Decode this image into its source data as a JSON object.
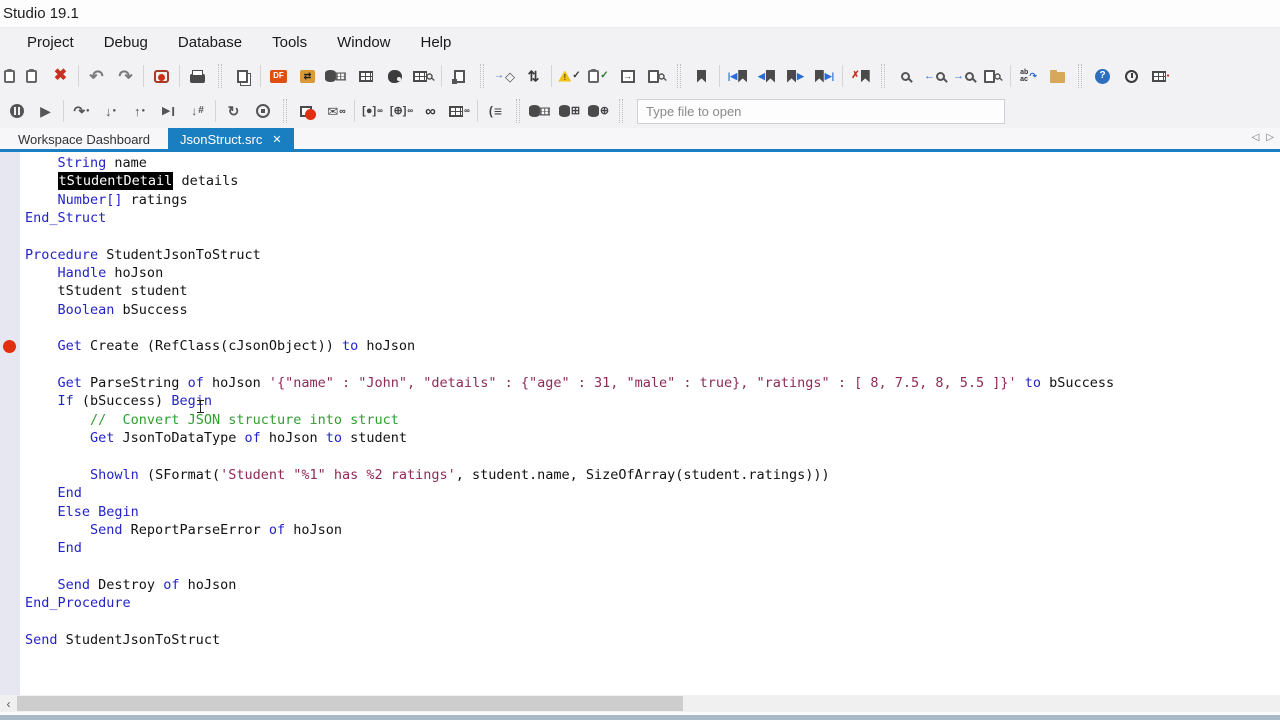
{
  "window": {
    "title": "Studio 19.1"
  },
  "menu": {
    "items": [
      "Project",
      "Debug",
      "Database",
      "Tools",
      "Window",
      "Help"
    ]
  },
  "toolbars": {
    "row1": [
      {
        "name": "paste-edge-icon",
        "w": 15,
        "parts": [
          {
            "cls": "clip"
          }
        ]
      },
      {
        "name": "paste-icon",
        "parts": [
          {
            "cls": "clip"
          }
        ]
      },
      {
        "name": "delete-icon",
        "parts": [
          {
            "g": "✖",
            "c": "#c5321f",
            "s": 16,
            "b": 1
          }
        ]
      },
      {
        "type": "sep"
      },
      {
        "name": "undo-icon",
        "parts": [
          {
            "g": "↶",
            "c": "#7a7a7a",
            "s": 17,
            "b": 1
          }
        ]
      },
      {
        "name": "redo-icon",
        "parts": [
          {
            "g": "↷",
            "c": "#7a7a7a",
            "s": 17,
            "b": 1
          }
        ]
      },
      {
        "type": "sep"
      },
      {
        "name": "compile-icon",
        "parts": [
          {
            "cls": "rec"
          }
        ]
      },
      {
        "type": "sep"
      },
      {
        "name": "print-icon",
        "parts": [
          {
            "cls": "prn"
          }
        ]
      },
      {
        "type": "grip"
      },
      {
        "name": "copy-code-icon",
        "parts": [
          {
            "cls": "doc2"
          }
        ]
      },
      {
        "type": "sep"
      },
      {
        "name": "dataflex-studio-icon",
        "parts": [
          {
            "cls": "df",
            "g": "DF"
          }
        ]
      },
      {
        "name": "df-migrate-icon",
        "parts": [
          {
            "cls": "dfo",
            "g": "⇄"
          }
        ]
      },
      {
        "name": "data-dictionary-icon",
        "parts": [
          {
            "cls": "cyl"
          },
          {
            "cls": "tbl sm"
          }
        ]
      },
      {
        "name": "table-editor-icon",
        "parts": [
          {
            "cls": "tbl"
          }
        ]
      },
      {
        "name": "styles-icon",
        "parts": [
          {
            "cls": "pal"
          }
        ]
      },
      {
        "name": "table-lookup-icon",
        "parts": [
          {
            "cls": "tbl"
          },
          {
            "cls": "mag sm"
          }
        ]
      },
      {
        "type": "sep"
      },
      {
        "name": "new-file-icon",
        "parts": [
          {
            "cls": "docsq"
          }
        ]
      },
      {
        "type": "grip"
      },
      {
        "name": "deploy-icon",
        "parts": [
          {
            "g": "→",
            "c": "#2b6cd4",
            "s": 10,
            "b": 1
          },
          {
            "g": "◇",
            "c": "#555",
            "s": 13
          }
        ]
      },
      {
        "name": "references-icon",
        "parts": [
          {
            "g": "⇅",
            "c": "#3a3a3a",
            "s": 14,
            "b": 1
          }
        ]
      },
      {
        "type": "sep"
      },
      {
        "name": "check-errors-icon",
        "parts": [
          {
            "cls": "warn",
            "g": "!"
          },
          {
            "g": "✓",
            "c": "#333",
            "s": 10,
            "b": 1
          }
        ]
      },
      {
        "name": "todo-list-icon",
        "parts": [
          {
            "cls": "clip"
          },
          {
            "g": "✓",
            "c": "#2a7a2a",
            "s": 10,
            "b": 1
          }
        ]
      },
      {
        "name": "run-program-icon",
        "parts": [
          {
            "cls": "docarr",
            "g": "→"
          }
        ]
      },
      {
        "name": "preview-icon",
        "parts": [
          {
            "cls": "doc"
          },
          {
            "cls": "mag sm"
          }
        ]
      },
      {
        "type": "grip"
      },
      {
        "name": "toggle-bookmark-icon",
        "parts": [
          {
            "cls": "bm"
          }
        ]
      },
      {
        "type": "sep"
      },
      {
        "name": "first-bookmark-icon",
        "parts": [
          {
            "g": "|◀",
            "c": "#2b6cd4",
            "s": 9,
            "b": 1
          },
          {
            "cls": "bm"
          }
        ]
      },
      {
        "name": "prev-bookmark-icon",
        "parts": [
          {
            "g": "◀",
            "c": "#2b6cd4",
            "s": 9,
            "b": 1
          },
          {
            "cls": "bm"
          }
        ]
      },
      {
        "name": "next-bookmark-icon",
        "parts": [
          {
            "cls": "bm"
          },
          {
            "g": "▶",
            "c": "#2b6cd4",
            "s": 9,
            "b": 1
          }
        ]
      },
      {
        "name": "last-bookmark-icon",
        "parts": [
          {
            "cls": "bm"
          },
          {
            "g": "▶|",
            "c": "#2b6cd4",
            "s": 9,
            "b": 1
          }
        ]
      },
      {
        "type": "sep"
      },
      {
        "name": "clear-bookmarks-icon",
        "parts": [
          {
            "g": "✗",
            "c": "#c5321f",
            "s": 10,
            "b": 1
          },
          {
            "cls": "bm"
          }
        ]
      },
      {
        "type": "grip"
      },
      {
        "name": "find-icon",
        "parts": [
          {
            "cls": "mag"
          }
        ]
      },
      {
        "name": "find-prev-icon",
        "parts": [
          {
            "g": "←",
            "c": "#2b6cd4",
            "s": 11,
            "b": 1
          },
          {
            "cls": "mag"
          }
        ]
      },
      {
        "name": "find-next-icon",
        "parts": [
          {
            "g": "→",
            "c": "#2b6cd4",
            "s": 11,
            "b": 1
          },
          {
            "cls": "mag"
          }
        ]
      },
      {
        "name": "find-in-files-icon",
        "parts": [
          {
            "cls": "doc"
          },
          {
            "cls": "mag sm"
          }
        ]
      },
      {
        "type": "sep"
      },
      {
        "name": "replace-icon",
        "parts": [
          {
            "cls": "rep",
            "g": "ab\nac"
          },
          {
            "g": "↷",
            "c": "#2b6cd4",
            "s": 9,
            "b": 1
          }
        ]
      },
      {
        "name": "replace-in-files-icon",
        "parts": [
          {
            "cls": "fold"
          }
        ]
      },
      {
        "type": "grip"
      },
      {
        "name": "help-icon",
        "parts": [
          {
            "cls": "help",
            "g": "?"
          }
        ]
      },
      {
        "name": "whats-new-icon",
        "parts": [
          {
            "cls": "clk"
          }
        ]
      },
      {
        "name": "window-layout-icon",
        "parts": [
          {
            "cls": "tbl"
          },
          {
            "g": "▪",
            "c": "#c5321f",
            "s": 8
          }
        ]
      }
    ],
    "row2": [
      {
        "name": "pause-icon",
        "parts": [
          {
            "cls": "pau"
          }
        ]
      },
      {
        "name": "start-debug-icon",
        "parts": [
          {
            "g": "▶",
            "c": "#555",
            "s": 14
          }
        ]
      },
      {
        "type": "sep"
      },
      {
        "name": "step-over-icon",
        "parts": [
          {
            "g": "↷",
            "c": "#555",
            "s": 14,
            "b": 1
          },
          {
            "g": "●",
            "c": "#555",
            "s": 6
          }
        ]
      },
      {
        "name": "step-into-icon",
        "parts": [
          {
            "g": "↓",
            "c": "#555",
            "s": 13,
            "b": 1
          },
          {
            "g": "●",
            "c": "#555",
            "s": 6
          }
        ]
      },
      {
        "name": "step-out-icon",
        "parts": [
          {
            "g": "↑",
            "c": "#555",
            "s": 13,
            "b": 1
          },
          {
            "g": "●",
            "c": "#555",
            "s": 6
          }
        ]
      },
      {
        "name": "run-to-cursor-icon",
        "parts": [
          {
            "g": "▶",
            "c": "#555",
            "s": 11
          },
          {
            "g": "I",
            "c": "#555",
            "s": 13,
            "b": 1
          }
        ]
      },
      {
        "name": "set-next-statement-icon",
        "parts": [
          {
            "g": "↓",
            "c": "#555",
            "s": 12,
            "b": 1
          },
          {
            "g": "#",
            "c": "#555",
            "s": 10,
            "b": 1
          }
        ]
      },
      {
        "type": "sep"
      },
      {
        "name": "continue-icon",
        "parts": [
          {
            "g": "↻",
            "c": "#555",
            "s": 14,
            "b": 1
          }
        ]
      },
      {
        "name": "stop-debug-icon",
        "parts": [
          {
            "cls": "stp"
          }
        ]
      },
      {
        "type": "grip"
      },
      {
        "name": "toggle-breakpoint-icon",
        "parts": [
          {
            "cls": "winsq"
          },
          {
            "cls": "dotr ov"
          }
        ]
      },
      {
        "name": "breakpoint-list-icon",
        "parts": [
          {
            "g": "✉",
            "c": "#444",
            "s": 13
          },
          {
            "g": "∞",
            "c": "#333",
            "s": 9,
            "b": 1
          }
        ]
      },
      {
        "type": "sep"
      },
      {
        "name": "watch-icon",
        "parts": [
          {
            "g": "[●]",
            "c": "#444",
            "s": 11,
            "b": 1
          },
          {
            "g": "∞",
            "c": "#333",
            "s": 8,
            "b": 1
          }
        ]
      },
      {
        "name": "web-watch-icon",
        "parts": [
          {
            "g": "[⊕]",
            "c": "#444",
            "s": 11,
            "b": 1
          },
          {
            "g": "∞",
            "c": "#333",
            "s": 8,
            "b": 1
          }
        ]
      },
      {
        "name": "locals-icon",
        "parts": [
          {
            "g": "∞",
            "c": "#333",
            "s": 15,
            "b": 1
          }
        ]
      },
      {
        "name": "array-watch-icon",
        "parts": [
          {
            "cls": "tbl"
          },
          {
            "g": "∞",
            "c": "#333",
            "s": 8,
            "b": 1
          }
        ]
      },
      {
        "type": "sep"
      },
      {
        "name": "call-stack-icon",
        "parts": [
          {
            "g": "(",
            "c": "#444",
            "s": 12,
            "b": 1
          },
          {
            "g": "≡",
            "c": "#444",
            "s": 14,
            "b": 1
          }
        ]
      },
      {
        "type": "grip"
      },
      {
        "name": "db-explorer-icon",
        "parts": [
          {
            "cls": "cyl"
          },
          {
            "cls": "tbl sm"
          }
        ]
      },
      {
        "name": "db-builder-icon",
        "parts": [
          {
            "cls": "cyl"
          },
          {
            "g": "⊞",
            "c": "#444",
            "s": 11,
            "b": 1
          }
        ]
      },
      {
        "name": "web-app-server-icon",
        "parts": [
          {
            "cls": "cyl"
          },
          {
            "g": "⊕",
            "c": "#444",
            "s": 11,
            "b": 1
          }
        ]
      },
      {
        "type": "grip"
      }
    ]
  },
  "file_open": {
    "placeholder": "Type file to open"
  },
  "tab_bar": {
    "accent": "#1a7fc1",
    "scroll_left": "◁",
    "scroll_right": "▷",
    "tabs": [
      {
        "label": "Workspace Dashboard",
        "active": false
      },
      {
        "label": "JsonStruct.src",
        "active": true,
        "close": "✕"
      }
    ]
  },
  "editor": {
    "colors": {
      "keyword": "#2323c8",
      "string": "#8e2a56",
      "comment": "#2f9e2f",
      "text": "#121212",
      "highlight_bg": "#000000",
      "highlight_text": "#ffffff",
      "breakpoint": "#e03010"
    },
    "lines": [
      {
        "tokens": [
          [
            "    ",
            "n"
          ],
          [
            "String",
            "k"
          ],
          [
            " name",
            "n"
          ]
        ]
      },
      {
        "tokens": [
          [
            "    ",
            "n"
          ],
          [
            "tStudentDetail",
            "h"
          ],
          [
            " details",
            "n"
          ]
        ]
      },
      {
        "tokens": [
          [
            "    ",
            "n"
          ],
          [
            "Number[]",
            "k"
          ],
          [
            " ratings",
            "n"
          ]
        ]
      },
      {
        "tokens": [
          [
            "End_Struct",
            "k"
          ]
        ]
      },
      {
        "tokens": []
      },
      {
        "tokens": [
          [
            "Procedure",
            "k"
          ],
          [
            " StudentJsonToStruct",
            "n"
          ]
        ]
      },
      {
        "tokens": [
          [
            "    ",
            "n"
          ],
          [
            "Handle",
            "k"
          ],
          [
            " hoJson",
            "n"
          ]
        ]
      },
      {
        "tokens": [
          [
            "    tStudent student",
            "n"
          ]
        ]
      },
      {
        "tokens": [
          [
            "    ",
            "n"
          ],
          [
            "Boolean",
            "k"
          ],
          [
            " bSuccess",
            "n"
          ]
        ]
      },
      {
        "tokens": []
      },
      {
        "bp": true,
        "tokens": [
          [
            "    ",
            "n"
          ],
          [
            "Get",
            "k"
          ],
          [
            " Create (RefClass(cJsonObject)) ",
            "n"
          ],
          [
            "to",
            "k"
          ],
          [
            " hoJson",
            "n"
          ]
        ]
      },
      {
        "tokens": []
      },
      {
        "tokens": [
          [
            "    ",
            "n"
          ],
          [
            "Get",
            "k"
          ],
          [
            " ParseString ",
            "n"
          ],
          [
            "of",
            "k"
          ],
          [
            " hoJson ",
            "n"
          ],
          [
            "'{\"name\" : \"John\", \"details\" : {\"age\" : 31, \"male\" : true}, \"ratings\" : [ 8, 7.5, 8, 5.5 ]}'",
            "s"
          ],
          [
            " ",
            "n"
          ],
          [
            "to",
            "k"
          ],
          [
            " bSuccess",
            "n"
          ]
        ]
      },
      {
        "tokens": [
          [
            "    ",
            "n"
          ],
          [
            "If",
            "k"
          ],
          [
            " (bSuccess) ",
            "n"
          ],
          [
            "Begin",
            "k"
          ]
        ]
      },
      {
        "tokens": [
          [
            "        ",
            "n"
          ],
          [
            "//  Convert JSON structure into struct",
            "c"
          ]
        ]
      },
      {
        "tokens": [
          [
            "        ",
            "n"
          ],
          [
            "Get",
            "k"
          ],
          [
            " JsonToDataType ",
            "n"
          ],
          [
            "of",
            "k"
          ],
          [
            " hoJson ",
            "n"
          ],
          [
            "to",
            "k"
          ],
          [
            " student",
            "n"
          ]
        ]
      },
      {
        "tokens": []
      },
      {
        "tokens": [
          [
            "        ",
            "n"
          ],
          [
            "Showln",
            "k"
          ],
          [
            " (SFormat(",
            "n"
          ],
          [
            "'Student \"%1\" has %2 ratings'",
            "s"
          ],
          [
            ", student.name, SizeOfArray(student.ratings)))",
            "n"
          ]
        ]
      },
      {
        "tokens": [
          [
            "    ",
            "n"
          ],
          [
            "End",
            "k"
          ]
        ]
      },
      {
        "tokens": [
          [
            "    ",
            "n"
          ],
          [
            "Else",
            "k"
          ],
          [
            " ",
            "n"
          ],
          [
            "Begin",
            "k"
          ]
        ]
      },
      {
        "tokens": [
          [
            "        ",
            "n"
          ],
          [
            "Send",
            "k"
          ],
          [
            " ReportParseError ",
            "n"
          ],
          [
            "of",
            "k"
          ],
          [
            " hoJson",
            "n"
          ]
        ]
      },
      {
        "tokens": [
          [
            "    ",
            "n"
          ],
          [
            "End",
            "k"
          ]
        ]
      },
      {
        "tokens": []
      },
      {
        "tokens": [
          [
            "    ",
            "n"
          ],
          [
            "Send",
            "k"
          ],
          [
            " Destroy ",
            "n"
          ],
          [
            "of",
            "k"
          ],
          [
            " hoJson",
            "n"
          ]
        ]
      },
      {
        "tokens": [
          [
            "End_Procedure",
            "k"
          ]
        ]
      },
      {
        "tokens": []
      },
      {
        "tokens": [
          [
            "Send",
            "k"
          ],
          [
            " StudentJsonToStruct",
            "n"
          ]
        ]
      }
    ]
  },
  "scrollbar": {
    "left_arrow": "‹"
  }
}
